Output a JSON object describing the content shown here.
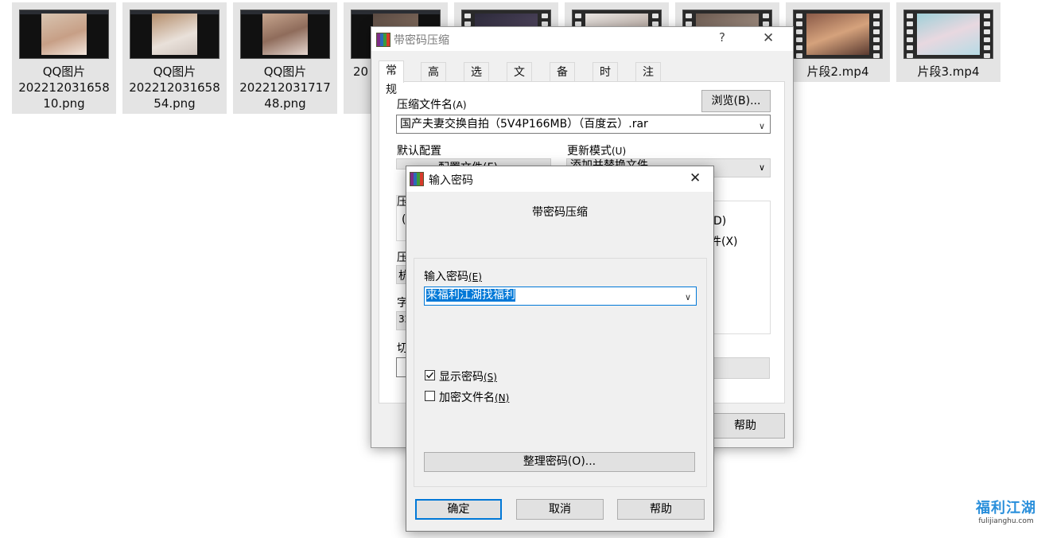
{
  "explorer": {
    "files": [
      {
        "name_line1": "QQ图片",
        "name_line2": "202212031658",
        "name_line3": "10.png",
        "kind": "image"
      },
      {
        "name_line1": "QQ图片",
        "name_line2": "202212031658",
        "name_line3": "54.png",
        "kind": "image"
      },
      {
        "name_line1": "QQ图片",
        "name_line2": "202212031717",
        "name_line3": "48.png",
        "kind": "image"
      },
      {
        "name_line1": "",
        "name_line2": "20",
        "name_line3": "",
        "kind": "image"
      },
      {
        "name_line1": "",
        "name_line2": "",
        "name_line3": "",
        "kind": "video"
      },
      {
        "name_line1": "",
        "name_line2": "",
        "name_line3": "",
        "kind": "video"
      },
      {
        "name_line1": "",
        "name_line2": "",
        "name_line3": "",
        "kind": "video"
      },
      {
        "name_line1": "片段2.mp4",
        "name_line2": "",
        "name_line3": "",
        "kind": "video"
      },
      {
        "name_line1": "片段3.mp4",
        "name_line2": "",
        "name_line3": "",
        "kind": "video"
      }
    ]
  },
  "main_dialog": {
    "title": "带密码压缩",
    "help_glyph": "?",
    "close_glyph": "✕",
    "tabs": [
      "常规",
      "高级",
      "选项",
      "文件",
      "备份",
      "时间",
      "注释"
    ],
    "archive_name_label": "压缩文件名",
    "archive_name_hotkey": "(A)",
    "browse_button": "浏览(B)...",
    "archive_name_value": "国产夫妻交换自拍（5V4P166MB）（百度云）.rar",
    "default_profile_label": "默认配置",
    "profile_button": "配置文件(F)...",
    "update_mode_label": "更新模式",
    "update_mode_hotkey": "(U)",
    "update_mode_value": "添加并替换文件",
    "partial_labels": [
      "压",
      "字",
      "切",
      "压",
      "杭",
      "32"
    ],
    "right_opt_1": "D)",
    "right_opt_2": "件(X)",
    "help_button": "帮助"
  },
  "password_dialog": {
    "title": "输入密码",
    "close_glyph": "✕",
    "heading": "带密码压缩",
    "password_label": "输入密码",
    "password_hotkey": "(E)",
    "password_value": "来福利江湖找福利",
    "show_password_label": "显示密码",
    "show_password_hotkey": "(S)",
    "show_password_checked": true,
    "encrypt_names_label": "加密文件名",
    "encrypt_names_hotkey": "(N)",
    "encrypt_names_checked": false,
    "organize_button": "整理密码(O)...",
    "ok_button": "确定",
    "cancel_button": "取消",
    "help_button": "帮助"
  },
  "watermark": {
    "brand": "福利江湖",
    "url": "fulijianghu.com"
  },
  "colors": {
    "selection": "#0078d7",
    "tile_bg": "#e4e4e4",
    "dialog_bg": "#f0f0f0"
  }
}
